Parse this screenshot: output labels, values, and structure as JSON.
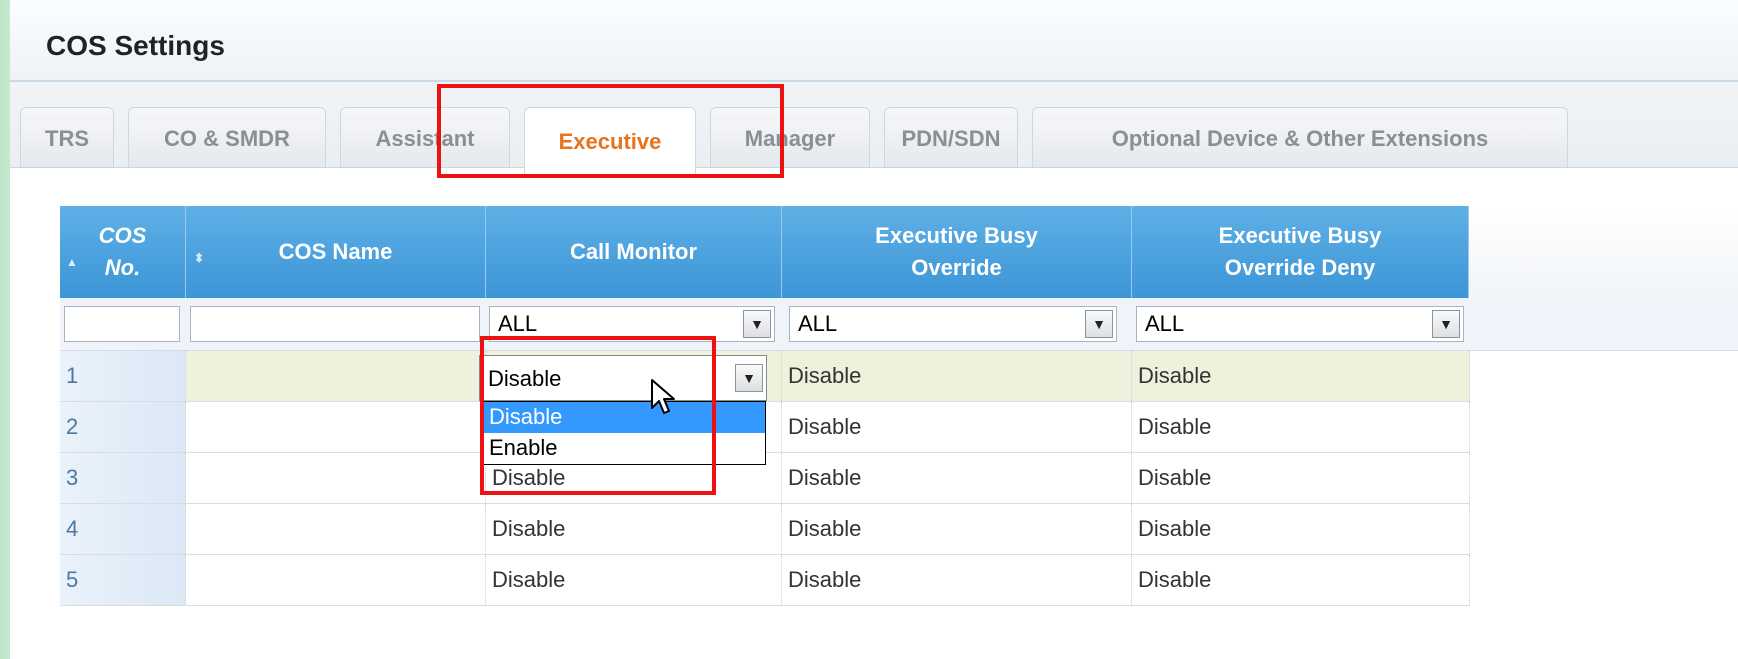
{
  "window": {
    "title": "COS Settings"
  },
  "tabs": [
    {
      "label": "TRS",
      "active": false
    },
    {
      "label": "CO & SMDR",
      "active": false
    },
    {
      "label": "Assistant",
      "active": false
    },
    {
      "label": "Executive",
      "active": true
    },
    {
      "label": "Manager",
      "active": false
    },
    {
      "label": "PDN/SDN",
      "active": false
    },
    {
      "label": "Optional Device & Other Extensions",
      "active": false
    }
  ],
  "grid": {
    "columns": {
      "cos_no_line1": "COS",
      "cos_no_line2": "No.",
      "cos_name": "COS Name",
      "call_monitor": "Call Monitor",
      "busy_override_line1": "Executive Busy",
      "busy_override_line2": "Override",
      "busy_override_deny_line1": "Executive Busy",
      "busy_override_deny_line2": "Override Deny"
    },
    "sort_icons": {
      "cos_no": "sort-up-icon",
      "cos_name": "sort-both-icon"
    },
    "filters": {
      "cos_no": "",
      "cos_name": "",
      "call_monitor": "ALL",
      "busy_override": "ALL",
      "busy_override_deny": "ALL"
    },
    "rows": [
      {
        "no": "1",
        "name": "",
        "call_monitor": "Disable",
        "busy_override": "Disable",
        "busy_override_deny": "Disable"
      },
      {
        "no": "2",
        "name": "",
        "call_monitor": "",
        "busy_override": "Disable",
        "busy_override_deny": "Disable"
      },
      {
        "no": "3",
        "name": "",
        "call_monitor": "Disable",
        "busy_override": "Disable",
        "busy_override_deny": "Disable"
      },
      {
        "no": "4",
        "name": "",
        "call_monitor": "Disable",
        "busy_override": "Disable",
        "busy_override_deny": "Disable"
      },
      {
        "no": "5",
        "name": "",
        "call_monitor": "Disable",
        "busy_override": "Disable",
        "busy_override_deny": "Disable"
      }
    ],
    "editor": {
      "value": "Disable",
      "options": [
        "Disable",
        "Enable"
      ],
      "highlighted": "Disable"
    }
  },
  "colors": {
    "header_blue": "#4aa1de",
    "active_tab_text": "#e8731c",
    "highlight_box": "#ee1111",
    "option_highlight": "#3399ff"
  }
}
